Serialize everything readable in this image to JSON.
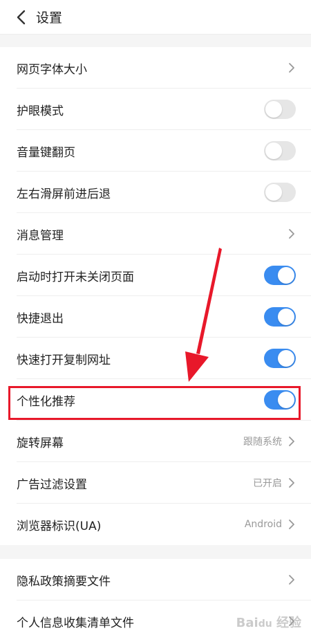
{
  "header": {
    "title": "设置",
    "back_icon": "chevron-left-icon"
  },
  "settings_group_1": [
    {
      "label": "网页字体大小",
      "type": "link"
    },
    {
      "label": "护眼模式",
      "type": "toggle",
      "on": false
    },
    {
      "label": "音量键翻页",
      "type": "toggle",
      "on": false
    },
    {
      "label": "左右滑屏前进后退",
      "type": "toggle",
      "on": false
    },
    {
      "label": "消息管理",
      "type": "link"
    },
    {
      "label": "启动时打开未关闭页面",
      "type": "toggle",
      "on": true
    },
    {
      "label": "快捷退出",
      "type": "toggle",
      "on": true
    },
    {
      "label": "快速打开复制网址",
      "type": "toggle",
      "on": true
    },
    {
      "label": "个性化推荐",
      "type": "toggle",
      "on": true
    },
    {
      "label": "旋转屏幕",
      "type": "link",
      "value": "跟随系统"
    },
    {
      "label": "广告过滤设置",
      "type": "link",
      "value": "已开启"
    },
    {
      "label": "浏览器标识(UA)",
      "type": "link",
      "value": "Android"
    }
  ],
  "settings_group_2": [
    {
      "label": "隐私政策摘要文件",
      "type": "link"
    },
    {
      "label": "个人信息收集清单文件",
      "type": "link"
    }
  ],
  "colors": {
    "toggle_on": "#3a8cf0",
    "toggle_off": "#e6e6e6",
    "annotation": "#e8182a"
  },
  "watermark": "Baidu 经验"
}
